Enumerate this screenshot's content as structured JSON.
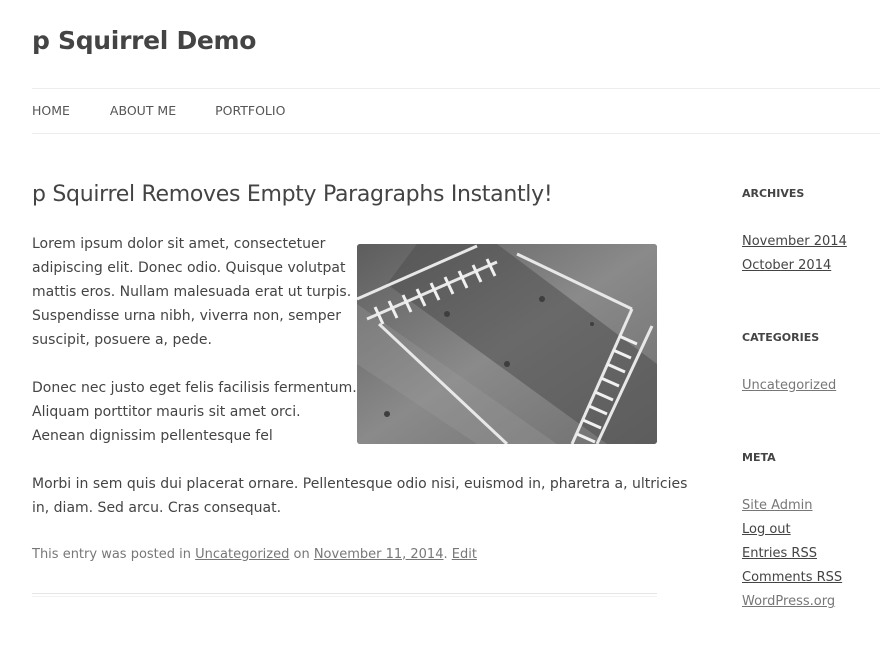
{
  "site": {
    "title": "p Squirrel Demo"
  },
  "nav": {
    "items": [
      "HOME",
      "ABOUT ME",
      "PORTFOLIO"
    ]
  },
  "post": {
    "title": "p Squirrel Removes Empty Paragraphs Instantly!",
    "para1_lines": [
      "Lorem ipsum dolor sit amet, consectetuer",
      "adipiscing elit. Donec odio. Quisque volutpat",
      "mattis eros. Nullam malesuada erat ut turpis.",
      "Suspendisse urna nibh, viverra non, semper",
      "suscipit, posuere a, pede."
    ],
    "para2_lines": [
      "Donec nec justo eget felis facilisis fermentum.",
      "Aliquam porttitor mauris sit amet orci.",
      "Aenean dignissim pellentesque fel"
    ],
    "para3_lines": [
      "Morbi in sem quis dui placerat ornare. Pellentesque odio nisi, euismod in, pharetra a, ultricies",
      "in, diam. Sed arcu. Cras consequat."
    ],
    "meta": {
      "prefix": "This entry was posted in ",
      "category": "Uncategorized",
      "on": " on ",
      "date": "November 11, 2014",
      "sep": ". ",
      "edit": "Edit"
    }
  },
  "sidebar": {
    "archives": {
      "title": "ARCHIVES",
      "items": [
        "November 2014",
        "October 2014"
      ]
    },
    "categories": {
      "title": "CATEGORIES",
      "items": [
        "Uncategorized"
      ]
    },
    "meta": {
      "title": "META",
      "items": [
        "Site Admin",
        "Log out",
        "Entries RSS",
        "Comments RSS",
        "WordPress.org"
      ]
    }
  }
}
